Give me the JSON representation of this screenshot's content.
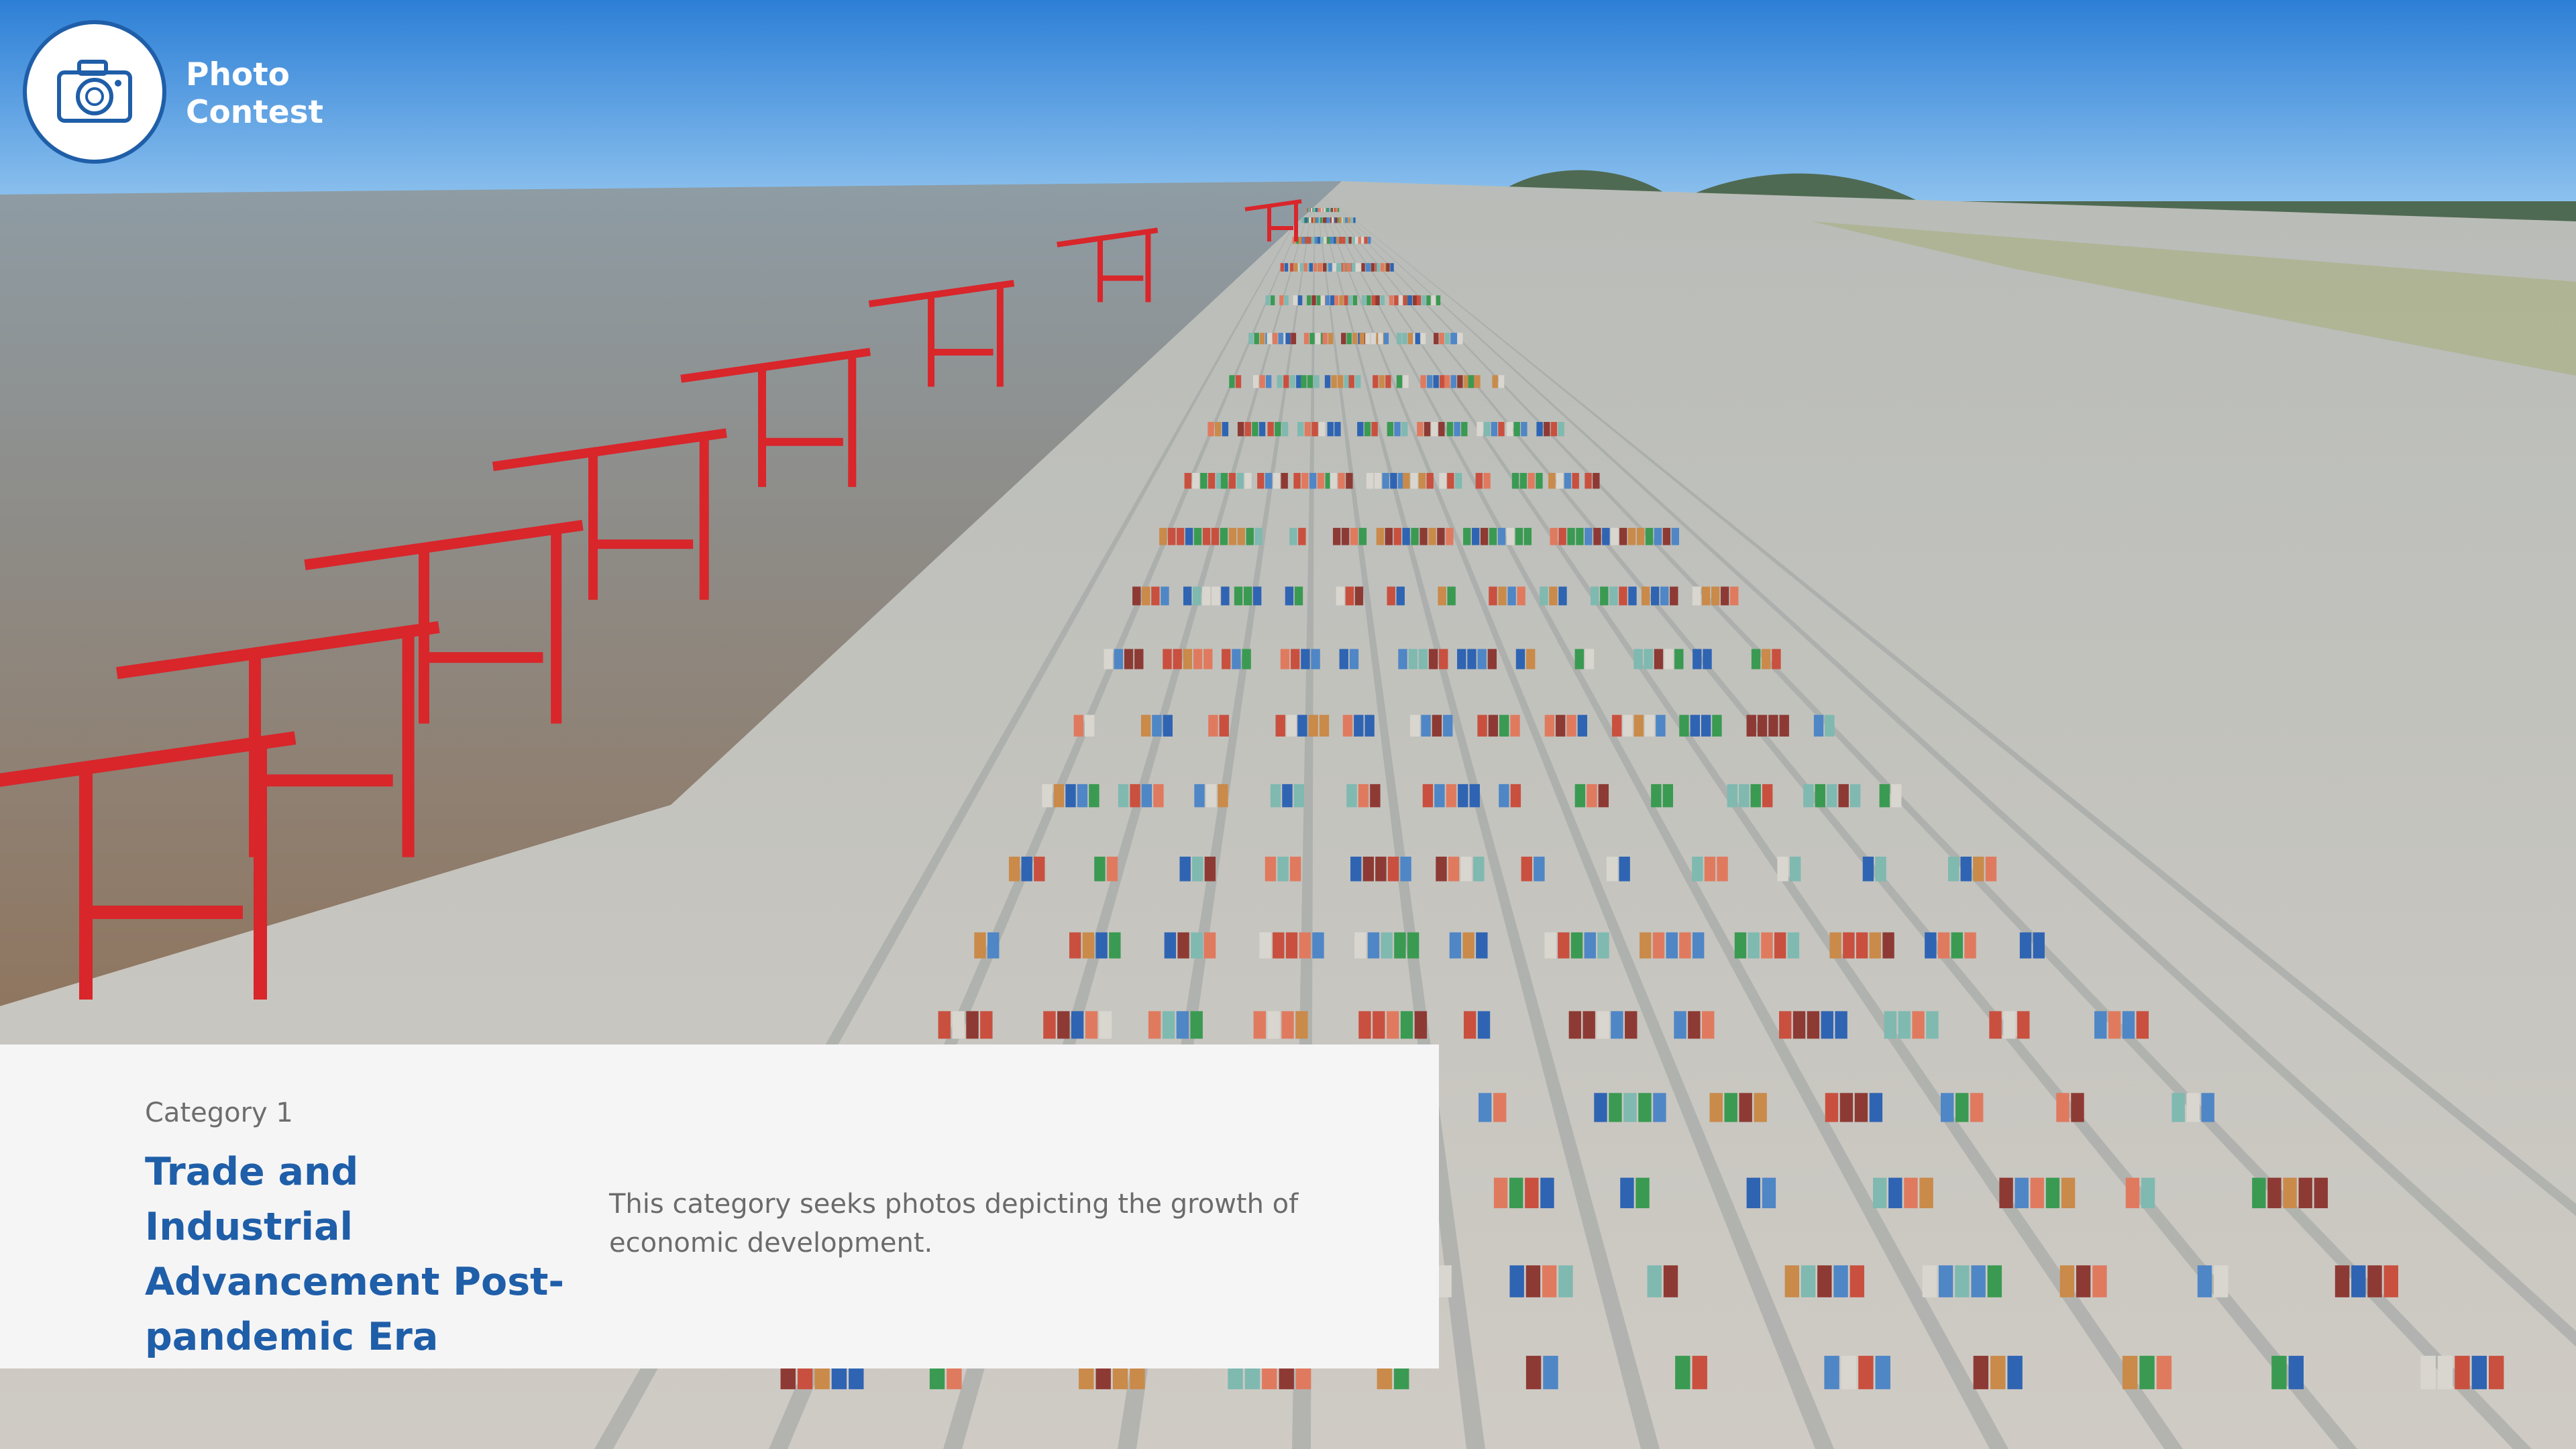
{
  "brand": {
    "line1": "Photo",
    "line2": "Contest",
    "icon": "camera-icon"
  },
  "category": {
    "label": "Category 1",
    "title": "Trade and Industrial Advancement Post-pandemic Era",
    "description": "This category seeks photos depicting the growth of economic development."
  },
  "colors": {
    "accent": "#1f5ea8",
    "panel": "#f5f5f6",
    "sky": "#3b86d8",
    "sea": "#9c8a78",
    "crane": "#d8262b"
  }
}
